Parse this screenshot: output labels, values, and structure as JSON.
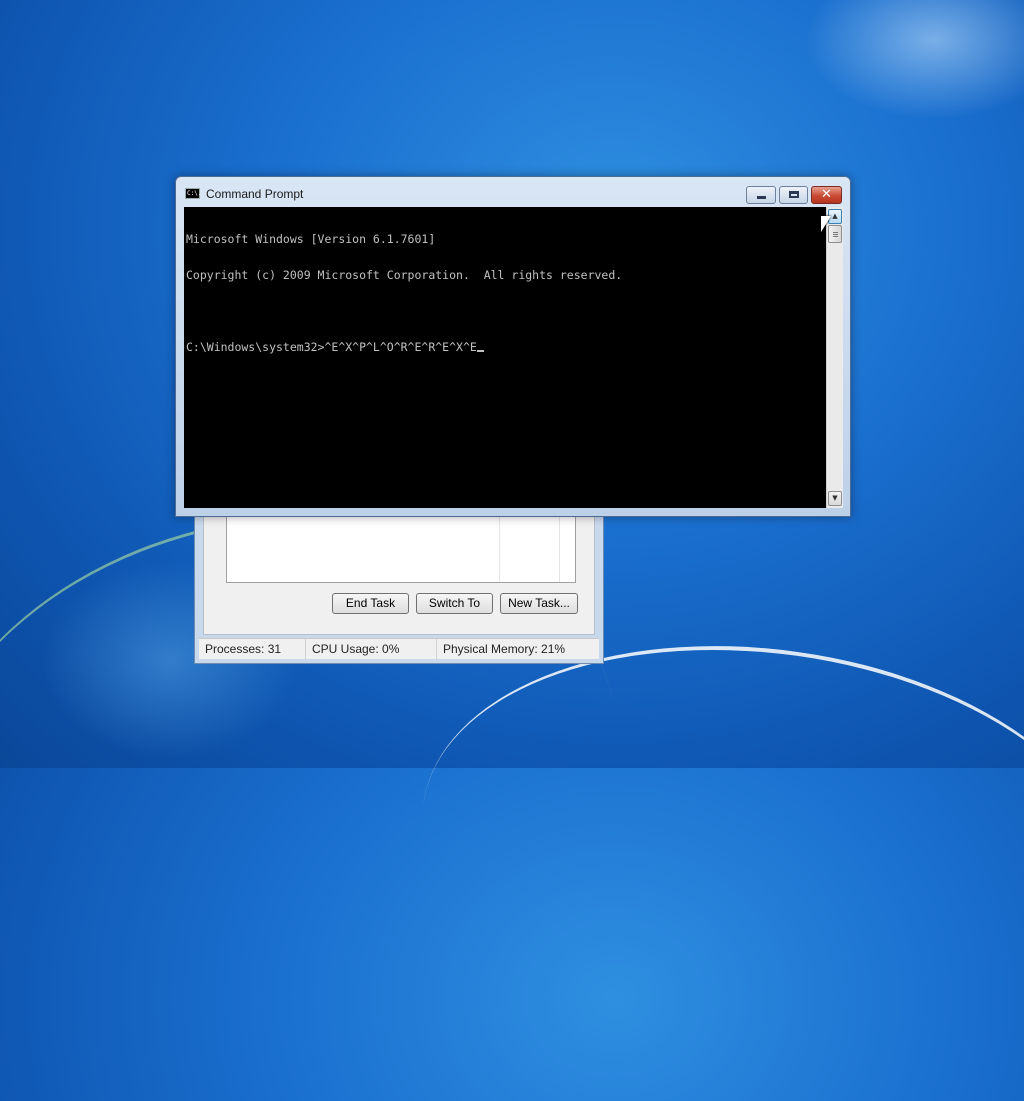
{
  "cmd_window": {
    "title": "Command Prompt",
    "icon": "cmd-icon",
    "icon_text": "C:\\.",
    "minimize_icon": "minimize-icon",
    "maximize_icon": "maximize-icon",
    "close_symbol": "✕",
    "console_lines": [
      "Microsoft Windows [Version 6.1.7601]",
      "Copyright (c) 2009 Microsoft Corporation.  All rights reserved.",
      "",
      "C:\\Windows\\system32>^E^X^P^L^O^R^E^R^E^X^E"
    ],
    "scroll_up_symbol": "▲",
    "scroll_down_symbol": "▼"
  },
  "task_manager": {
    "buttons": {
      "end_task": "End Task",
      "switch_to": "Switch To",
      "new_task": "New Task..."
    },
    "status": {
      "processes": "Processes: 31",
      "cpu": "CPU Usage: 0%",
      "memory": "Physical Memory: 21%"
    }
  },
  "colors": {
    "desktop": "#1a6fcf",
    "console_bg": "#000000",
    "console_text": "#c0c0c0",
    "close_button": "#c94a34"
  }
}
